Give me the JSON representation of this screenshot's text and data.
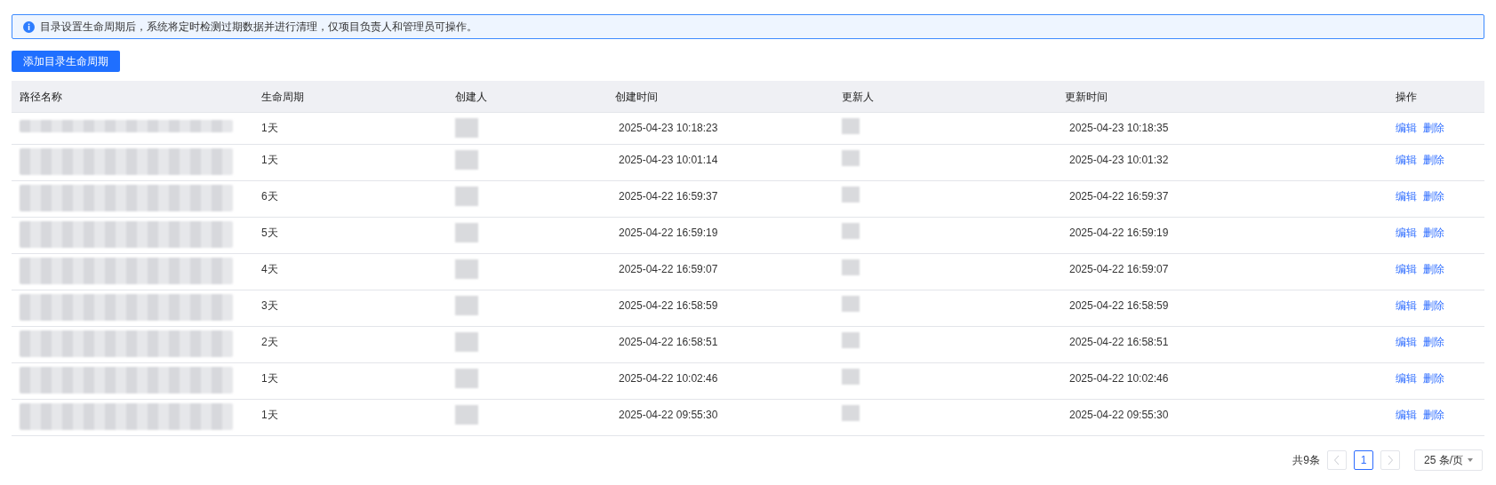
{
  "notice": {
    "text": "目录设置生命周期后，系统将定时检测过期数据并进行清理，仅项目负责人和管理员可操作。"
  },
  "add_button": {
    "label": "添加目录生命周期"
  },
  "table": {
    "columns": [
      "路径名称",
      "生命周期",
      "创建人",
      "创建时间",
      "更新人",
      "更新时间",
      "操作"
    ],
    "rows": [
      {
        "lifecycle": "1天",
        "created_at": "2025-04-23 10:18:23",
        "updated_at": "2025-04-23 10:18:35",
        "actions": [
          "编辑",
          "删除"
        ]
      },
      {
        "lifecycle": "1天",
        "created_at": "2025-04-23 10:01:14",
        "updated_at": "2025-04-23 10:01:32",
        "actions": [
          "编辑",
          "删除"
        ]
      },
      {
        "lifecycle": "6天",
        "created_at": "2025-04-22 16:59:37",
        "updated_at": "2025-04-22 16:59:37",
        "actions": [
          "编辑",
          "删除"
        ]
      },
      {
        "lifecycle": "5天",
        "created_at": "2025-04-22 16:59:19",
        "updated_at": "2025-04-22 16:59:19",
        "actions": [
          "编辑",
          "删除"
        ]
      },
      {
        "lifecycle": "4天",
        "created_at": "2025-04-22 16:59:07",
        "updated_at": "2025-04-22 16:59:07",
        "actions": [
          "编辑",
          "删除"
        ]
      },
      {
        "lifecycle": "3天",
        "created_at": "2025-04-22 16:58:59",
        "updated_at": "2025-04-22 16:58:59",
        "actions": [
          "编辑",
          "删除"
        ]
      },
      {
        "lifecycle": "2天",
        "created_at": "2025-04-22 16:58:51",
        "updated_at": "2025-04-22 16:58:51",
        "actions": [
          "编辑",
          "删除"
        ]
      },
      {
        "lifecycle": "1天",
        "created_at": "2025-04-22 10:02:46",
        "updated_at": "2025-04-22 10:02:46",
        "actions": [
          "编辑",
          "删除"
        ]
      },
      {
        "lifecycle": "1天",
        "created_at": "2025-04-22 09:55:30",
        "updated_at": "2025-04-22 09:55:30",
        "actions": [
          "编辑",
          "删除"
        ]
      }
    ]
  },
  "pagination": {
    "total": "共9条",
    "prev_disabled": true,
    "next_disabled": true,
    "pages": [
      {
        "label": "1",
        "selected": true
      }
    ],
    "page_size": "25 条/页"
  }
}
